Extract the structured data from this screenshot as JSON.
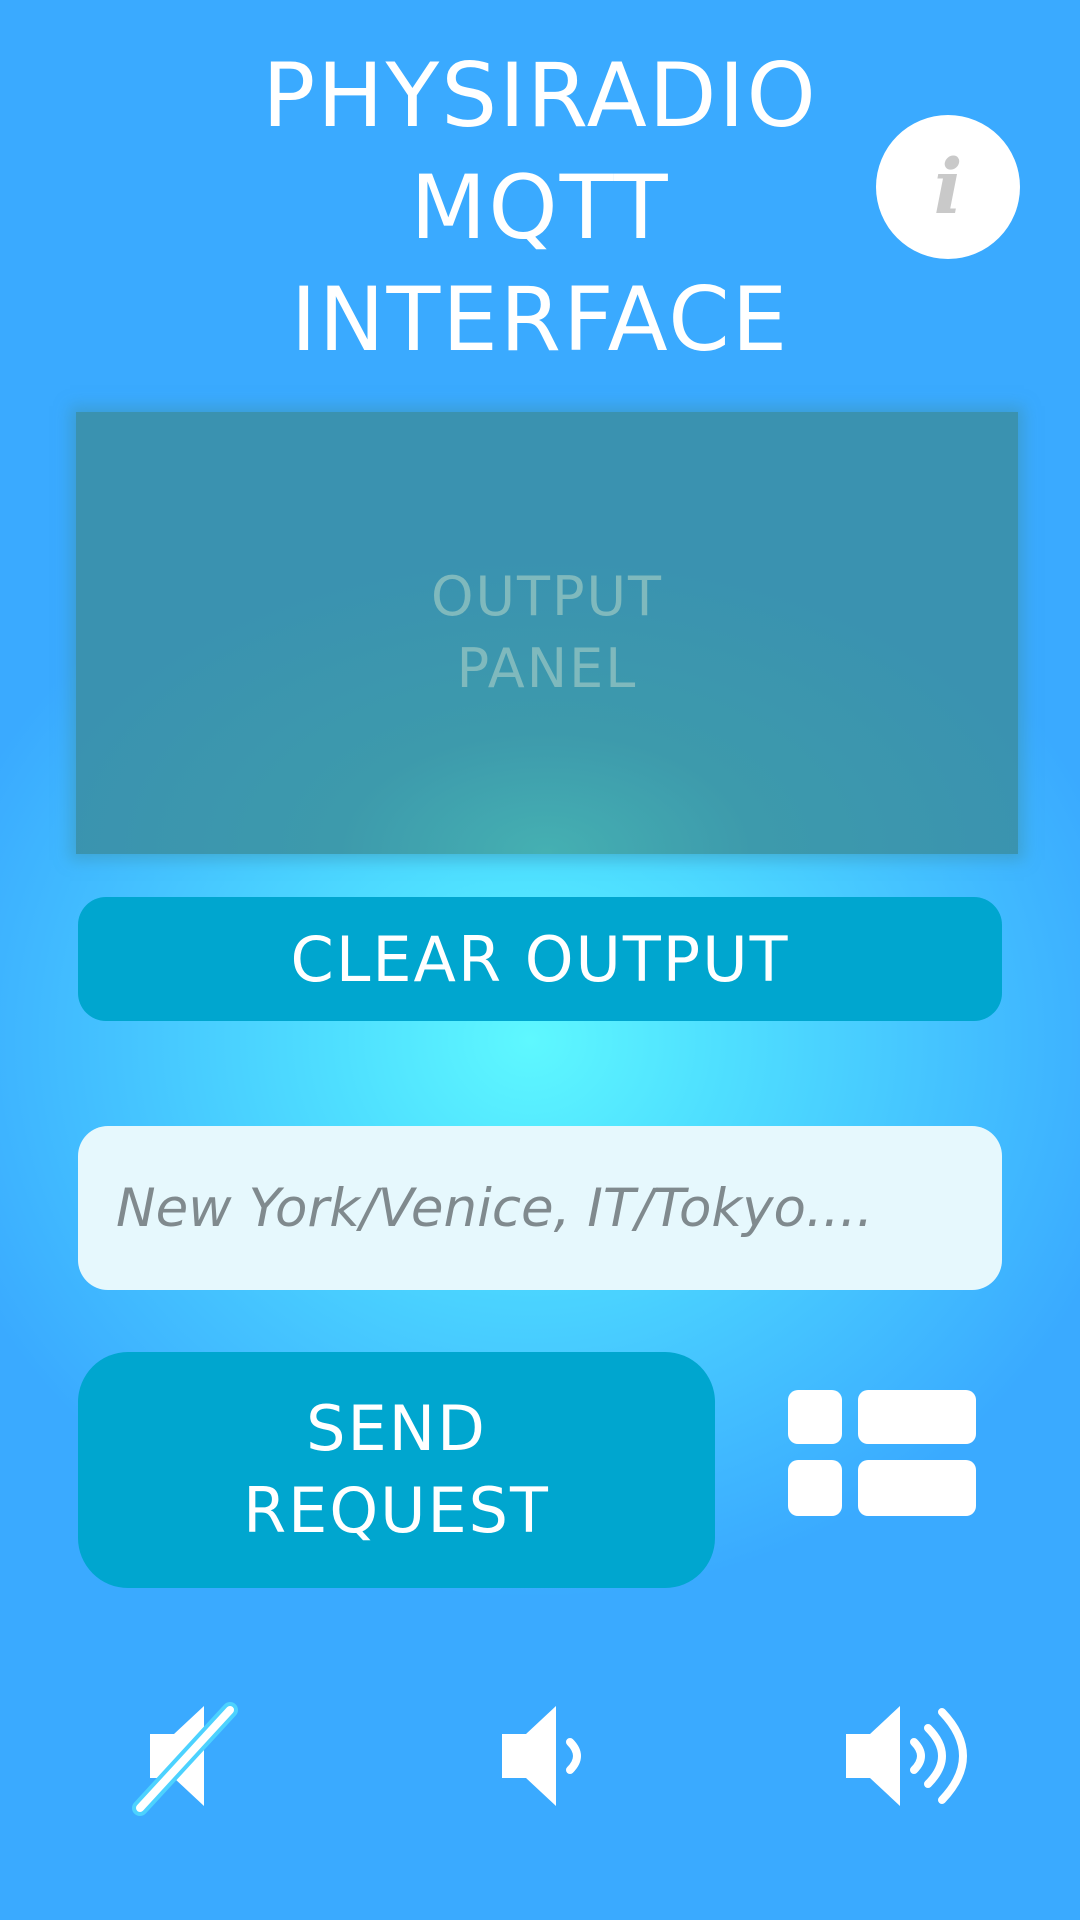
{
  "header": {
    "title_lines": [
      "PHYSIRADIO",
      "MQTT",
      "INTERFACE"
    ],
    "info_icon": "info-icon",
    "info_glyph": "i"
  },
  "output": {
    "placeholder_lines": [
      "OUTPUT",
      "PANEL"
    ]
  },
  "actions": {
    "clear_label": "CLEAR OUTPUT",
    "send_label_lines": [
      "SEND",
      "REQUEST"
    ],
    "layout_toggle_icon": "grid-list-icon"
  },
  "search": {
    "placeholder": "New York/Venice, IT/Tokyo....",
    "value": ""
  },
  "volume": {
    "icons": [
      "volume-mute-icon",
      "volume-low-icon",
      "volume-high-icon"
    ]
  },
  "colors": {
    "button": "#00a6cf",
    "background_center": "#5ef8ff",
    "background_edge": "#3aaaff"
  }
}
